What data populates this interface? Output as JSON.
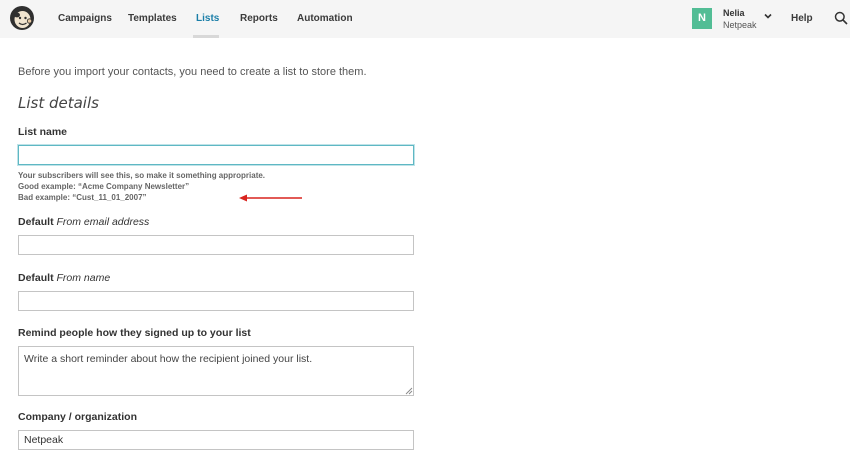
{
  "nav": {
    "items": [
      "Campaigns",
      "Templates",
      "Lists",
      "Reports",
      "Automation"
    ],
    "active": "Lists"
  },
  "user": {
    "initial": "N",
    "name": "Nelia",
    "org": "Netpeak"
  },
  "header": {
    "help": "Help"
  },
  "icons": [
    "mailchimp-logo-icon",
    "chevron-down-icon",
    "search-icon",
    "red-arrow-icon",
    "resize-grip-icon"
  ],
  "colors": {
    "accent": "#1a7ea8",
    "avatar": "#52bd95",
    "focus": "#5fb8c4",
    "arrow": "#d9241f",
    "topbar": "#f5f5f5"
  },
  "form": {
    "intro": "Before you import your contacts, you need to create a list to store them.",
    "section_title": "List details",
    "list_name": {
      "label": "List name",
      "value": "",
      "hint1": "Your subscribers will see this, so make it something appropriate.",
      "hint2": "Good example: “Acme Company Newsletter”",
      "hint3": "Bad example: “Cust_11_01_2007”"
    },
    "from_email": {
      "label_bold": "Default",
      "label_italic": "From email address",
      "value": ""
    },
    "from_name": {
      "label_bold": "Default",
      "label_italic": "From name",
      "value": ""
    },
    "remind": {
      "label": "Remind people how they signed up to your list",
      "value": "Write a short reminder about how the recipient joined your list."
    },
    "company": {
      "label": "Company / organization",
      "value": "Netpeak"
    }
  }
}
